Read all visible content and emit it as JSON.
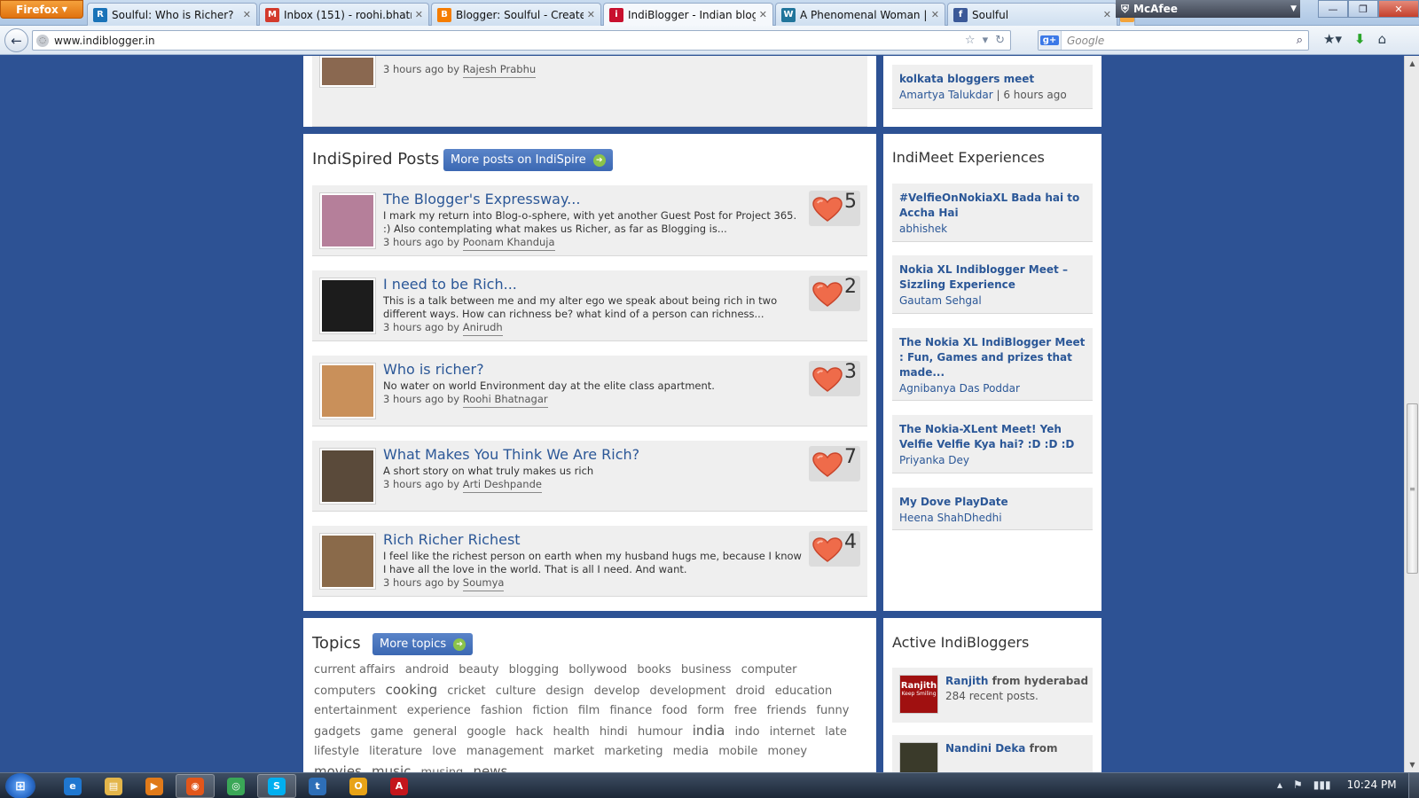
{
  "browser": {
    "app_button": "Firefox",
    "tabs": [
      {
        "title": "Soulful: Who is Richer?",
        "fav_color": "#1a73b8",
        "fav_char": "R"
      },
      {
        "title": "Inbox (151) - roohi.bhatna...",
        "fav_color": "#d33a2c",
        "fav_char": "M"
      },
      {
        "title": "Blogger: Soulful - Create p...",
        "fav_color": "#f57d00",
        "fav_char": "B"
      },
      {
        "title": "IndiBlogger - Indian blog ...",
        "fav_color": "#c8102e",
        "fav_char": "i"
      },
      {
        "title": "A Phenomenal Woman | h...",
        "fav_color": "#21759b",
        "fav_char": "W"
      },
      {
        "title": "Soulful",
        "fav_color": "#3b5998",
        "fav_char": "f"
      }
    ],
    "mcafee_label": "McAfee",
    "url": "www.indiblogger.in",
    "search_placeholder": "Google",
    "search_engine_badge": "g+"
  },
  "top_post": {
    "meta_prefix": "3 hours ago by",
    "author": "Rajesh Prabhu"
  },
  "top_side": {
    "title": "kolkata bloggers meet",
    "author": "Amartya Talukdar",
    "time": "6 hours ago"
  },
  "indispire": {
    "heading": "IndiSpired Posts",
    "more_label": "More posts on IndiSpire",
    "posts": [
      {
        "title": "The Blogger's Expressway...",
        "desc": "I mark my return into Blog-o-sphere, with yet another Guest Post for Project 365. :) Also contemplating what makes us Richer, as far as Blogging is...",
        "meta_prefix": "3 hours ago by",
        "author": "Poonam Khanduja",
        "likes": "5",
        "thumb_color": "#b57f9a"
      },
      {
        "title": "I need to be Rich...",
        "desc": "This is a talk between me and my alter ego we speak about being rich in two different ways. How can richness be? what kind of a person can richness...",
        "meta_prefix": "3 hours ago by",
        "author": "Anirudh",
        "likes": "2",
        "thumb_color": "#1c1c1c"
      },
      {
        "title": "Who is richer?",
        "desc": "No water on world Environment day at the elite class apartment.",
        "meta_prefix": "3 hours ago by",
        "author": "Roohi Bhatnagar",
        "likes": "3",
        "thumb_color": "#c9905a"
      },
      {
        "title": "What Makes You Think We Are Rich?",
        "desc": "A short story on what truly makes us rich",
        "meta_prefix": "3 hours ago by",
        "author": "Arti Deshpande",
        "likes": "7",
        "thumb_color": "#5a4a3a"
      },
      {
        "title": "Rich Richer Richest",
        "desc": "I feel like the richest person on earth when my husband hugs me, because I know I have all the love in the world. That is all I need. And want.",
        "meta_prefix": "3 hours ago by",
        "author": "Soumya",
        "likes": "4",
        "thumb_color": "#8a6a4a"
      }
    ]
  },
  "indimeet": {
    "heading": "IndiMeet Experiences",
    "items": [
      {
        "title": "#VelfieOnNokiaXL Bada hai to Accha Hai",
        "author": "abhishek"
      },
      {
        "title": "Nokia XL Indiblogger Meet – Sizzling Experience",
        "author": "Gautam Sehgal"
      },
      {
        "title": "The Nokia XL IndiBlogger Meet : Fun, Games and prizes that made...",
        "author": "Agnibanya Das Poddar"
      },
      {
        "title": "The Nokia-XLent Meet! Yeh Velfie Velfie Kya hai? :D :D :D",
        "author": "Priyanka Dey"
      },
      {
        "title": "My Dove PlayDate",
        "author": "Heena ShahDhedhi"
      }
    ]
  },
  "topics": {
    "heading": "Topics",
    "more_label": "More topics",
    "tags": [
      {
        "label": "current affairs",
        "big": false
      },
      {
        "label": "android",
        "big": false
      },
      {
        "label": "beauty",
        "big": false
      },
      {
        "label": "blogging",
        "big": false
      },
      {
        "label": "bollywood",
        "big": false
      },
      {
        "label": "books",
        "big": false
      },
      {
        "label": "business",
        "big": false
      },
      {
        "label": "computer",
        "big": false
      },
      {
        "label": "computers",
        "big": false
      },
      {
        "label": "cooking",
        "big": true
      },
      {
        "label": "cricket",
        "big": false
      },
      {
        "label": "culture",
        "big": false
      },
      {
        "label": "design",
        "big": false
      },
      {
        "label": "develop",
        "big": false
      },
      {
        "label": "development",
        "big": false
      },
      {
        "label": "droid",
        "big": false
      },
      {
        "label": "education",
        "big": false
      },
      {
        "label": "entertainment",
        "big": false
      },
      {
        "label": "experience",
        "big": false
      },
      {
        "label": "fashion",
        "big": false
      },
      {
        "label": "fiction",
        "big": false
      },
      {
        "label": "film",
        "big": false
      },
      {
        "label": "finance",
        "big": false
      },
      {
        "label": "food",
        "big": false
      },
      {
        "label": "form",
        "big": false
      },
      {
        "label": "free",
        "big": false
      },
      {
        "label": "friends",
        "big": false
      },
      {
        "label": "funny",
        "big": false
      },
      {
        "label": "gadgets",
        "big": false
      },
      {
        "label": "game",
        "big": false
      },
      {
        "label": "general",
        "big": false
      },
      {
        "label": "google",
        "big": false
      },
      {
        "label": "hack",
        "big": false
      },
      {
        "label": "health",
        "big": false
      },
      {
        "label": "hindi",
        "big": false
      },
      {
        "label": "humour",
        "big": false
      },
      {
        "label": "india",
        "big": true
      },
      {
        "label": "indo",
        "big": false
      },
      {
        "label": "internet",
        "big": false
      },
      {
        "label": "late",
        "big": false
      },
      {
        "label": "lifestyle",
        "big": false
      },
      {
        "label": "literature",
        "big": false
      },
      {
        "label": "love",
        "big": false
      },
      {
        "label": "management",
        "big": false
      },
      {
        "label": "market",
        "big": false
      },
      {
        "label": "marketing",
        "big": false
      },
      {
        "label": "media",
        "big": false
      },
      {
        "label": "mobile",
        "big": false
      },
      {
        "label": "money",
        "big": false
      },
      {
        "label": "movies",
        "big": true
      },
      {
        "label": "music",
        "big": true
      },
      {
        "label": "musing",
        "big": false
      },
      {
        "label": "news",
        "big": true
      }
    ]
  },
  "active": {
    "heading": "Active IndiBloggers",
    "items": [
      {
        "name": "Ranjith",
        "from": "from hyderabad",
        "posts": "284 recent posts.",
        "thumb_text": "Ranjith",
        "thumb_sub": "Keep Smiling"
      },
      {
        "name": "Nandini Deka",
        "from": "from",
        "posts": "",
        "thumb_text": "",
        "thumb_sub": ""
      }
    ]
  },
  "taskbar": {
    "clock": "10:24 PM",
    "apps": [
      {
        "name": "ie",
        "color": "#1f77d0",
        "char": "e"
      },
      {
        "name": "explorer",
        "color": "#e3b54a",
        "char": "▤"
      },
      {
        "name": "media-player",
        "color": "#e07a1a",
        "char": "▶"
      },
      {
        "name": "firefox",
        "color": "#e2561a",
        "char": "◉"
      },
      {
        "name": "chrome",
        "color": "#3aa757",
        "char": "◎"
      },
      {
        "name": "skype",
        "color": "#00aff0",
        "char": "S"
      },
      {
        "name": "twitter",
        "color": "#2e6fb8",
        "char": "t"
      },
      {
        "name": "outlook",
        "color": "#e8a317",
        "char": "O"
      },
      {
        "name": "acrobat",
        "color": "#c4161c",
        "char": "A"
      }
    ]
  }
}
